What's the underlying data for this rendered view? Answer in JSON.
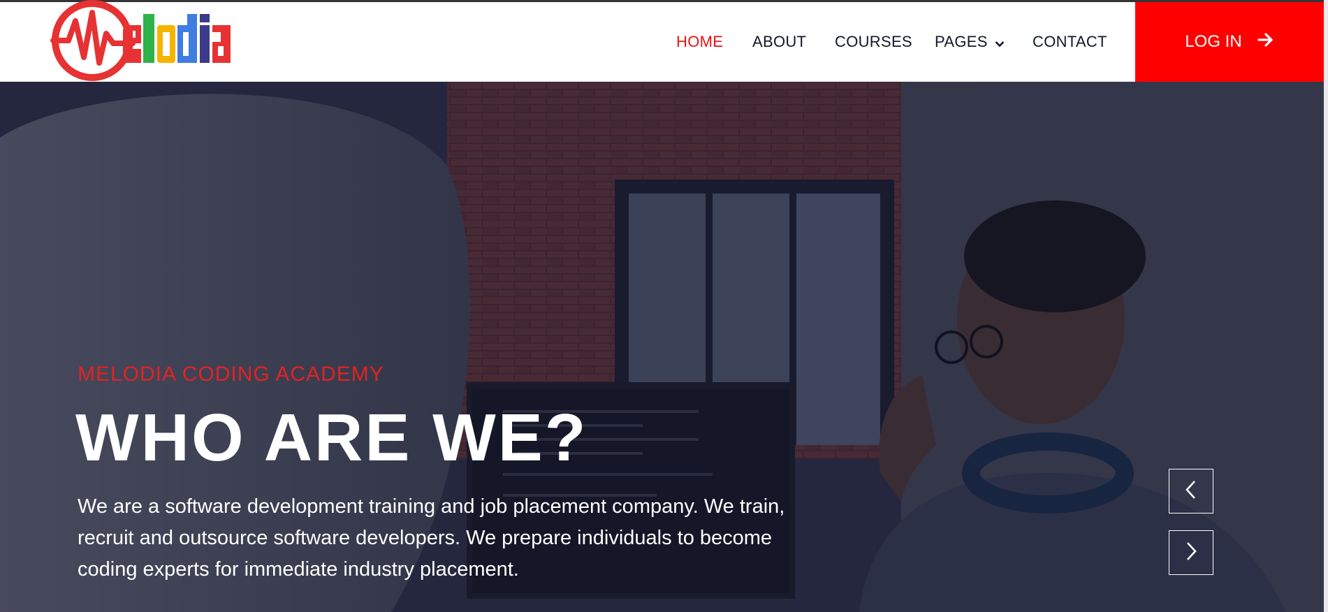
{
  "brand": {
    "name": "elodia",
    "colors": {
      "red": "#e63232",
      "green": "#2fb24a",
      "yellow": "#f5b400",
      "blue": "#3f7de0",
      "navy": "#3b3a8c"
    }
  },
  "nav": {
    "items": [
      {
        "label": "HOME",
        "active": true
      },
      {
        "label": "ABOUT",
        "active": false
      },
      {
        "label": "COURSES",
        "active": false
      },
      {
        "label": "PAGES",
        "active": false,
        "dropdown": true
      },
      {
        "label": "CONTACT",
        "active": false
      }
    ],
    "login_label": "LOG IN",
    "login_icon": "arrow-right-icon"
  },
  "hero": {
    "subtitle": "MELODIA CODING ACADEMY",
    "title": "WHO ARE WE?",
    "text": "We are a software development training and job placement company. We train, recruit and outsource software developers. We prepare individuals to become coding experts for immediate industry placement.",
    "prev_icon": "chevron-left-icon",
    "next_icon": "chevron-right-icon"
  },
  "colors": {
    "accent": "#ff0000",
    "active_nav": "#ee1111",
    "text_dark": "#111827"
  }
}
